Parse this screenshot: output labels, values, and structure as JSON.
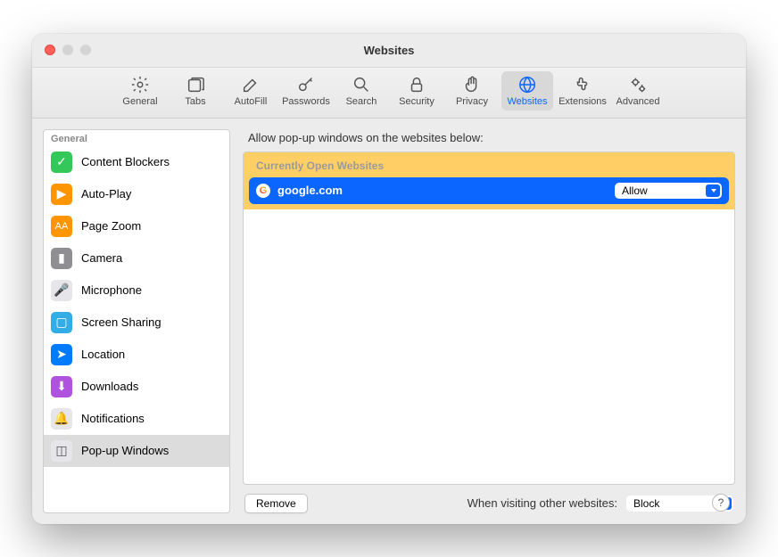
{
  "window": {
    "title": "Websites"
  },
  "toolbar": {
    "items": [
      {
        "label": "General"
      },
      {
        "label": "Tabs"
      },
      {
        "label": "AutoFill"
      },
      {
        "label": "Passwords"
      },
      {
        "label": "Search"
      },
      {
        "label": "Security"
      },
      {
        "label": "Privacy"
      },
      {
        "label": "Websites"
      },
      {
        "label": "Extensions"
      },
      {
        "label": "Advanced"
      }
    ],
    "active_index": 7
  },
  "sidebar": {
    "group_header": "General",
    "items": [
      {
        "label": "Content Blockers"
      },
      {
        "label": "Auto-Play"
      },
      {
        "label": "Page Zoom"
      },
      {
        "label": "Camera"
      },
      {
        "label": "Microphone"
      },
      {
        "label": "Screen Sharing"
      },
      {
        "label": "Location"
      },
      {
        "label": "Downloads"
      },
      {
        "label": "Notifications"
      },
      {
        "label": "Pop-up Windows"
      }
    ],
    "selected_index": 9
  },
  "main": {
    "headline": "Allow pop-up windows on the websites below:",
    "section_header": "Currently Open Websites",
    "rows": [
      {
        "site": "google.com",
        "setting": "Allow"
      }
    ],
    "remove_label": "Remove",
    "other_sites_label": "When visiting other websites:",
    "other_sites_value": "Block"
  }
}
